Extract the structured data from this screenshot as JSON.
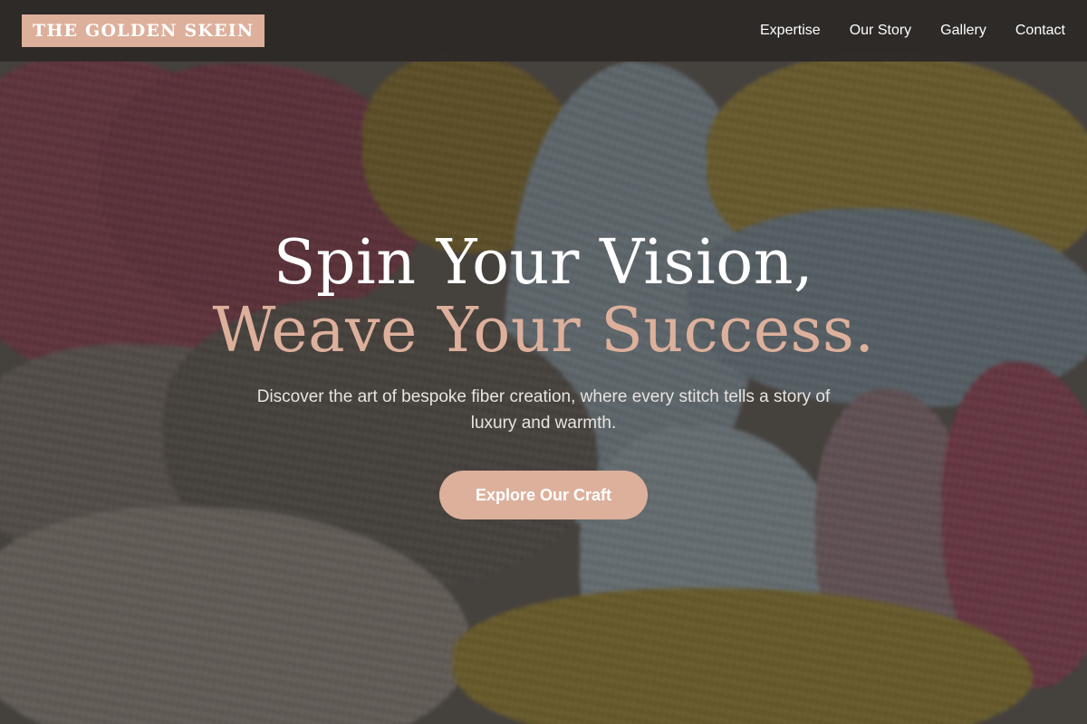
{
  "brand": {
    "logo_text": "THE GOLDEN SKEIN"
  },
  "nav": {
    "items": [
      {
        "label": "Expertise"
      },
      {
        "label": "Our Story"
      },
      {
        "label": "Gallery"
      },
      {
        "label": "Contact"
      }
    ]
  },
  "hero": {
    "headline_line1": "Spin Your Vision,",
    "headline_line2": "Weave Your Success.",
    "subtitle": "Discover the art of bespoke fiber creation, where every stitch tells a story of luxury and warmth.",
    "cta_label": "Explore Our Craft",
    "background_image": "knitted-blanket-photo"
  },
  "colors": {
    "accent": "#ddb09c",
    "navbar": "#2d2a28",
    "text_light": "#ffffff"
  }
}
